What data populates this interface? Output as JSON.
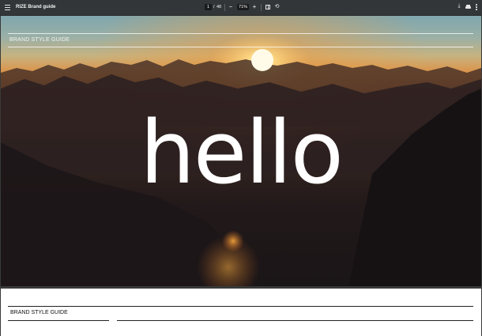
{
  "toolbar": {
    "title": "RIZE Brand guide",
    "current_page": "1",
    "page_separator": "/",
    "total_pages": "48",
    "zoom_out_label": "−",
    "zoom_level": "71%",
    "zoom_in_label": "+",
    "icons": {
      "menu": "menu-icon",
      "fit": "fit-to-page-icon",
      "rotate": "rotate-icon",
      "download": "download-icon",
      "print": "print-icon",
      "more": "more-vertical-icon"
    }
  },
  "page1": {
    "header_label": "BRAND STYLE GUIDE",
    "hero_text": "hello"
  },
  "page2": {
    "header_label": "BRAND STYLE GUIDE"
  },
  "colors": {
    "toolbar_bg": "#323639",
    "viewer_bg": "#3a3a3a",
    "sun": "#ffe9a8"
  }
}
